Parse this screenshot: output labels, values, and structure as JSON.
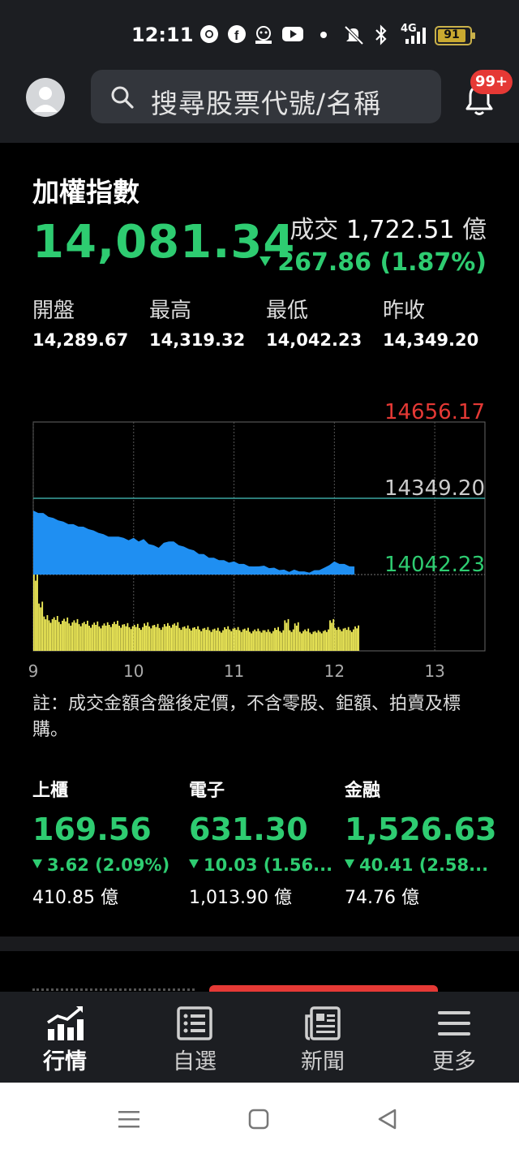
{
  "status_bar": {
    "time": "12:11",
    "network": "4G",
    "battery": "91",
    "icons": [
      "chrome-icon",
      "facebook-icon",
      "gomaji-icon",
      "youtube-icon",
      "dot-icon",
      "mute-icon",
      "bluetooth-icon",
      "signal-icon"
    ]
  },
  "header": {
    "search_placeholder": "搜尋股票代號/名稱",
    "notification_badge": "99+"
  },
  "index": {
    "name": "加權指數",
    "price": "14,081.34",
    "volume_label": "成交",
    "volume_value": "1,722.51",
    "volume_unit": "億",
    "change": "267.86 (1.87%)",
    "direction": "down"
  },
  "stats": [
    {
      "label": "開盤",
      "value": "14,289.67"
    },
    {
      "label": "最高",
      "value": "14,319.32"
    },
    {
      "label": "最低",
      "value": "14,042.23"
    },
    {
      "label": "昨收",
      "value": "14,349.20"
    }
  ],
  "chart_data": {
    "type": "area",
    "y_labels": {
      "high": "14656.17",
      "ref": "14349.20",
      "low": "14042.23"
    },
    "ylim": [
      14042.23,
      14656.17
    ],
    "reference": 14349.2,
    "x_ticks": [
      "9",
      "10",
      "11",
      "12",
      "13"
    ],
    "x_range": [
      9.0,
      13.5
    ],
    "price_series": {
      "x": [
        9.0,
        9.05,
        9.1,
        9.15,
        9.2,
        9.25,
        9.3,
        9.35,
        9.4,
        9.45,
        9.5,
        9.55,
        9.6,
        9.65,
        9.7,
        9.75,
        9.8,
        9.85,
        9.9,
        9.95,
        10.0,
        10.05,
        10.1,
        10.15,
        10.2,
        10.25,
        10.3,
        10.35,
        10.4,
        10.45,
        10.5,
        10.55,
        10.6,
        10.65,
        10.7,
        10.75,
        10.8,
        10.85,
        10.9,
        10.95,
        11.0,
        11.05,
        11.1,
        11.15,
        11.2,
        11.25,
        11.3,
        11.35,
        11.4,
        11.45,
        11.5,
        11.55,
        11.6,
        11.65,
        11.7,
        11.75,
        11.8,
        11.85,
        11.9,
        11.95,
        12.0,
        12.05,
        12.1,
        12.15,
        12.2
      ],
      "y": [
        14300,
        14295,
        14290,
        14280,
        14270,
        14265,
        14255,
        14250,
        14245,
        14240,
        14235,
        14230,
        14220,
        14215,
        14205,
        14200,
        14195,
        14200,
        14190,
        14185,
        14190,
        14180,
        14185,
        14170,
        14160,
        14155,
        14170,
        14180,
        14175,
        14165,
        14155,
        14150,
        14140,
        14130,
        14125,
        14115,
        14110,
        14105,
        14100,
        14095,
        14095,
        14090,
        14085,
        14080,
        14075,
        14080,
        14078,
        14073,
        14070,
        14065,
        14062,
        14058,
        14062,
        14060,
        14055,
        14055,
        14060,
        14065,
        14070,
        14085,
        14095,
        14090,
        14085,
        14080,
        14075
      ]
    },
    "volume_series": {
      "x": [
        9.0,
        9.05,
        9.1,
        9.15,
        9.2,
        9.25,
        9.3,
        9.35,
        9.4,
        9.45,
        9.5,
        9.55,
        9.6,
        9.65,
        9.7,
        9.75,
        9.8,
        9.85,
        9.9,
        9.95,
        10.0,
        10.05,
        10.1,
        10.15,
        10.2,
        10.25,
        10.3,
        10.35,
        10.4,
        10.45,
        10.5,
        10.55,
        10.6,
        10.65,
        10.7,
        10.75,
        10.8,
        10.85,
        10.9,
        10.95,
        11.0,
        11.05,
        11.1,
        11.15,
        11.2,
        11.25,
        11.3,
        11.35,
        11.4,
        11.45,
        11.5,
        11.55,
        11.6,
        11.65,
        11.7,
        11.75,
        11.8,
        11.85,
        11.9,
        11.95,
        12.0,
        12.05,
        12.1,
        12.15,
        12.2
      ],
      "v": [
        1.0,
        0.62,
        0.45,
        0.4,
        0.44,
        0.38,
        0.42,
        0.36,
        0.4,
        0.35,
        0.38,
        0.33,
        0.37,
        0.32,
        0.36,
        0.34,
        0.38,
        0.33,
        0.35,
        0.31,
        0.34,
        0.3,
        0.36,
        0.32,
        0.34,
        0.3,
        0.35,
        0.33,
        0.36,
        0.3,
        0.32,
        0.29,
        0.31,
        0.28,
        0.3,
        0.27,
        0.29,
        0.26,
        0.31,
        0.28,
        0.3,
        0.27,
        0.29,
        0.25,
        0.28,
        0.26,
        0.27,
        0.25,
        0.3,
        0.26,
        0.4,
        0.27,
        0.36,
        0.25,
        0.28,
        0.24,
        0.26,
        0.25,
        0.27,
        0.4,
        0.3,
        0.28,
        0.3,
        0.27,
        0.32
      ]
    },
    "colors": {
      "area": "#1f8ff2",
      "volume": "#f4f05a",
      "high_label": "#e53935",
      "low_label": "#2ecc71",
      "ref_label": "#cccccc"
    }
  },
  "note": "註：成交金額含盤後定價，不含零股、鉅額、拍賣及標購。",
  "tiles": [
    {
      "name": "上櫃",
      "value": "169.56",
      "change": "3.62 (2.09%)",
      "volume": "410.85 億"
    },
    {
      "name": "電子",
      "value": "631.30",
      "change": "10.03 (1.56...",
      "volume": "1,013.90 億"
    },
    {
      "name": "金融",
      "value": "1,526.63",
      "change": "40.41 (2.58...",
      "volume": "74.76 億"
    }
  ],
  "bottom_nav": [
    {
      "label": "行情",
      "icon": "chart-icon",
      "active": true
    },
    {
      "label": "自選",
      "icon": "list-icon",
      "active": false
    },
    {
      "label": "新聞",
      "icon": "news-icon",
      "active": false
    },
    {
      "label": "更多",
      "icon": "menu-icon",
      "active": false
    }
  ],
  "system_nav": [
    "recents-icon",
    "home-icon",
    "back-icon"
  ]
}
